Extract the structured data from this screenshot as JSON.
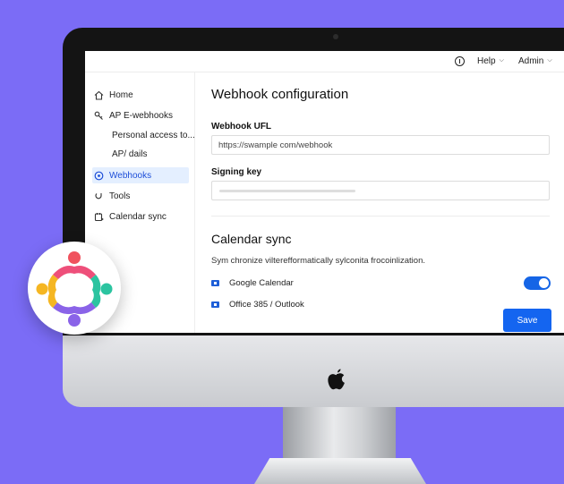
{
  "topbar": {
    "help_label": "Help",
    "admin_label": "Admin"
  },
  "sidebar": {
    "items": [
      {
        "label": "Home",
        "icon": "home-icon"
      },
      {
        "label": "AP E-webhooks",
        "icon": "key-icon"
      },
      {
        "label": "Personal access to...",
        "icon": ""
      },
      {
        "label": "AP/ dails",
        "icon": ""
      },
      {
        "label": "Webhooks",
        "icon": "webhook-icon",
        "active": true
      },
      {
        "label": "Tools",
        "icon": "wrench-icon"
      },
      {
        "label": "Calendar sync",
        "icon": "calendar-sync-icon"
      }
    ]
  },
  "main": {
    "title": "Webhook configuration",
    "webhook_url_label": "Webhook UFL",
    "webhook_url_value": "https://swample com/webhook",
    "signing_key_label": "Signing key",
    "calendar_title": "Calendar sync",
    "calendar_desc": "Sym chronize vilterefformatically sylconita frocoinlization.",
    "calendars": [
      {
        "label": "Google Calendar",
        "enabled": true
      },
      {
        "label": "Office 385 / Outlook"
      }
    ],
    "save_label": "Save"
  },
  "colors": {
    "background": "#7b6cf6",
    "accent": "#1465f0",
    "active_nav_bg": "#e4efff"
  }
}
